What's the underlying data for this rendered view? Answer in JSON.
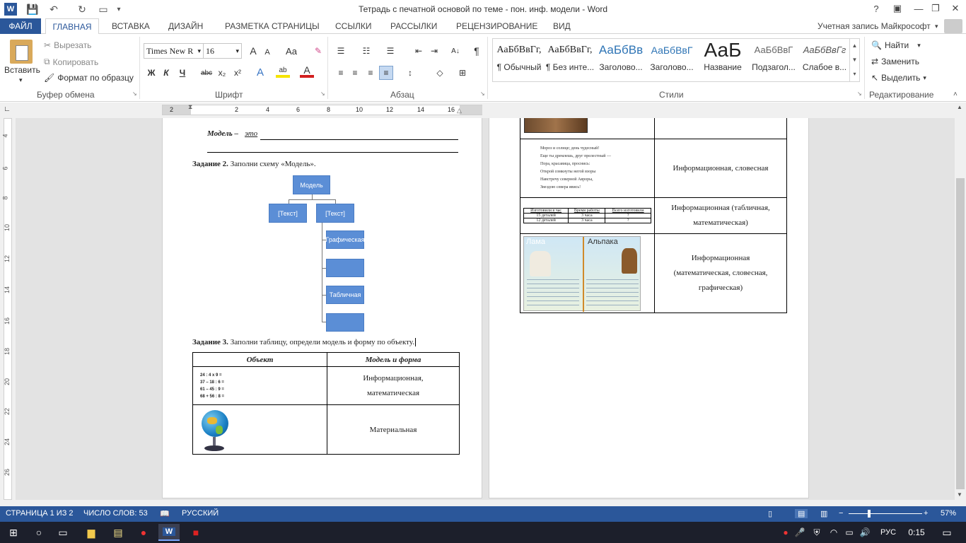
{
  "window": {
    "title": "Тетрадь с печатной основой по теме - пон. инф. модели - Word",
    "help": "?",
    "minimize": "—",
    "restore": "❐",
    "close": "✕"
  },
  "quick_access": {
    "word_icon": "W",
    "save": "💾",
    "undo": "↶",
    "redo": "↻"
  },
  "tabs": [
    "ФАЙЛ",
    "ГЛАВНАЯ",
    "ВСТАВКА",
    "ДИЗАЙН",
    "РАЗМЕТКА СТРАНИЦЫ",
    "ССЫЛКИ",
    "РАССЫЛКИ",
    "РЕЦЕНЗИРОВАНИЕ",
    "ВИД"
  ],
  "account": "Учетная запись Майкрософт",
  "clipboard": {
    "paste": "Вставить",
    "cut": "Вырезать",
    "copy": "Копировать",
    "format_painter": "Формат по образцу",
    "group": "Буфер обмена"
  },
  "font": {
    "name": "Times New R",
    "size": "16",
    "group": "Шрифт",
    "bold": "Ж",
    "italic": "К",
    "underline": "Ч",
    "strike": "abc",
    "sub": "x₂",
    "sup": "x²",
    "grow": "A",
    "shrink": "A",
    "case": "Aa",
    "effects": "A",
    "highlight": "ab",
    "color": "A"
  },
  "paragraph": {
    "group": "Абзац",
    "pilcrow": "¶",
    "sort": "A↓"
  },
  "styles": {
    "group": "Стили",
    "items": [
      {
        "preview": "АаБбВвГг,",
        "name": "¶ Обычный"
      },
      {
        "preview": "АаБбВвГг,",
        "name": "¶ Без инте..."
      },
      {
        "preview": "АаБбВв",
        "name": "Заголово..."
      },
      {
        "preview": "АаБбВвГ",
        "name": "Заголово..."
      },
      {
        "preview": "АаБ",
        "name": "Название"
      },
      {
        "preview": "АаБбВвГ",
        "name": "Подзагол..."
      },
      {
        "preview": "АаБбВвГг",
        "name": "Слабое в..."
      }
    ]
  },
  "editing": {
    "group": "Редактирование",
    "find": "Найти",
    "replace": "Заменить",
    "select": "Выделить"
  },
  "ruler": {
    "marks": [
      "2",
      "2",
      "4",
      "6",
      "8",
      "10",
      "12",
      "14",
      "16"
    ],
    "vmarks": [
      "4",
      "6",
      "8",
      "10",
      "12",
      "14",
      "16",
      "18",
      "20",
      "22",
      "24",
      "26"
    ]
  },
  "page1": {
    "model_label": "Модель – ",
    "model_def": "это",
    "task2_bold": "Задание 2.",
    "task2_text": " Заполни схему «Модель».",
    "schema": {
      "root": "Модель",
      "text1": "[Текст]",
      "text2": "[Текст]",
      "child1": "Графическая",
      "child2": "",
      "child3": "Табличная",
      "child4": ""
    },
    "task3_bold": "Задание 3.",
    "task3_text": " Заполни таблицу, определи модель и форму по объекту.",
    "table": {
      "headers": [
        "Объект",
        "Модель и форма"
      ],
      "math": [
        "24 : 4 x 9 =",
        "37 – 18 : 6 =",
        "61 – 45 : 9 =",
        "68 + 56 : 8 ="
      ],
      "row1": "Информационная, математическая",
      "row2": "Материальная"
    }
  },
  "page2": {
    "poem": [
      "Мороз и солнце; день чудесный!",
      "Еще ты дремлешь, друг прелестный —",
      "Пора, красавица, проснись:",
      "Открой сомкнуты негой взоры",
      "Навстречу северной Авроры,",
      "Звездою севера явись!"
    ],
    "poem_type": "Информационная, словесная",
    "mini_table": {
      "headers": [
        "Изготовили в час",
        "Время работы",
        "Всего изготовили"
      ],
      "rows": [
        [
          "15 деталей",
          "3 часа",
          "?"
        ],
        [
          "12 деталей",
          "3 часа",
          "?"
        ]
      ]
    },
    "table_type": "Информационная (табличная, математическая)",
    "llama": "Лама",
    "alpaca": "Альпака",
    "llama_type": "Информационная (математическая, словесная, графическая)"
  },
  "status": {
    "page": "СТРАНИЦА 1 ИЗ 2",
    "words": "ЧИСЛО СЛОВ: 53",
    "lang": "РУССКИЙ",
    "zoom": "57%"
  },
  "taskbar": {
    "lang": "РУС",
    "time": "0:15"
  },
  "colors": {
    "accent": "#2b579a",
    "smartart": "#5b8ed6"
  }
}
